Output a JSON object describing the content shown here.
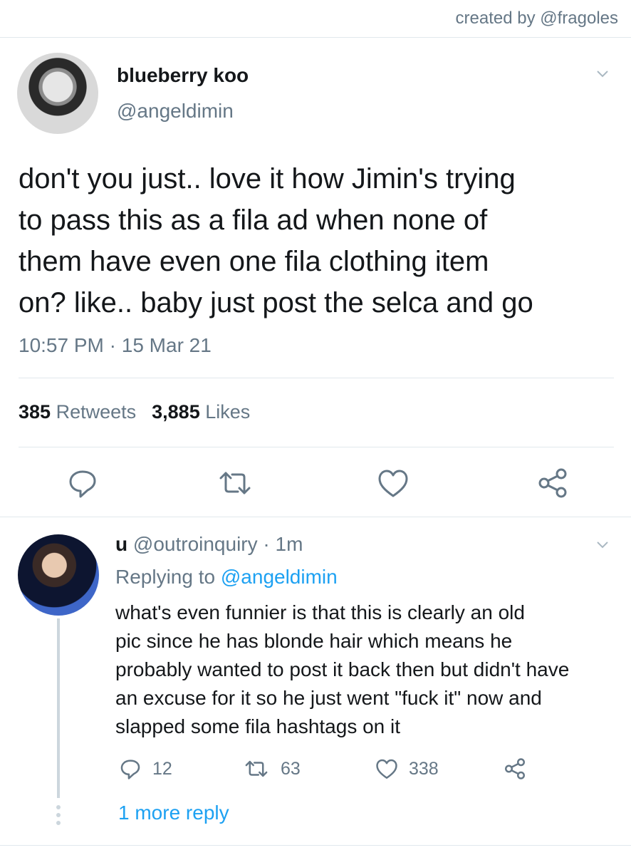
{
  "watermark": "created by @fragoles",
  "main_tweet": {
    "author_name": "blueberry koo",
    "author_handle": "@angeldimin",
    "text": "don't you just.. love it how Jimin's trying\nto pass this as a fila ad when none of\nthem have even one fila clothing item\non? like.. baby just post the selca and go",
    "time": "10:57 PM",
    "date": "15 Mar 21",
    "retweets_count": "385",
    "retweets_label": "Retweets",
    "likes_count": "3,885",
    "likes_label": "Likes",
    "actions": [
      "reply-icon",
      "retweet-icon",
      "like-icon",
      "share-icon"
    ]
  },
  "reply": {
    "author_name": "u",
    "author_handle": "@outroinquiry",
    "time_ago": "1m",
    "replying_label": "Replying to",
    "replying_to": "@angeldimin",
    "text": "what's even funnier is that this is clearly an old\npic since he has blonde hair which means he\nprobably wanted to post it back then but didn't have\nan excuse for it so he just went \"fuck it\" now and\nslapped some fila hashtags on it",
    "reply_count": "12",
    "retweet_count": "63",
    "like_count": "338",
    "more_replies": "1 more reply"
  },
  "colors": {
    "text": "#14171a",
    "secondary": "#657786",
    "link": "#1da1f2",
    "divider": "#e1e8ed"
  }
}
